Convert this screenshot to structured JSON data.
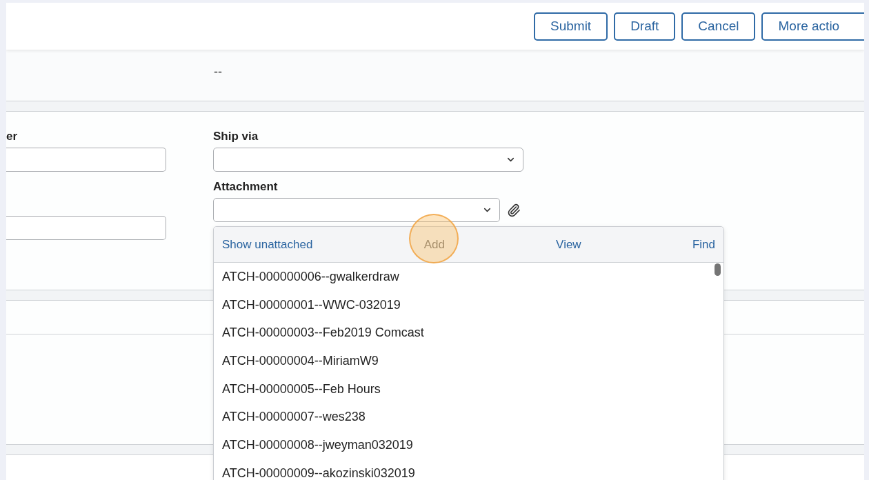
{
  "header": {
    "buttons": [
      {
        "label": "Submit"
      },
      {
        "label": "Draft"
      },
      {
        "label": "Cancel"
      },
      {
        "label": "More actio"
      }
    ]
  },
  "summary": {
    "value": "--"
  },
  "form": {
    "column_1_label": "er",
    "ship_via": {
      "label": "Ship via"
    },
    "attachment": {
      "label": "Attachment"
    }
  },
  "dropdown": {
    "actions": [
      {
        "label": "Show unattached",
        "disabled": false
      },
      {
        "label": "Add",
        "disabled": true
      },
      {
        "label": "View",
        "disabled": false
      },
      {
        "label": "Find",
        "disabled": false
      }
    ],
    "items": [
      "ATCH-000000006--gwalkerdraw",
      "ATCH-00000001--WWC-032019",
      "ATCH-00000003--Feb2019 Comcast",
      "ATCH-00000004--MiriamW9",
      "ATCH-00000005--Feb Hours",
      "ATCH-00000007--wes238",
      "ATCH-00000008--jweyman032019",
      "ATCH-00000009--akozinski032019"
    ]
  }
}
